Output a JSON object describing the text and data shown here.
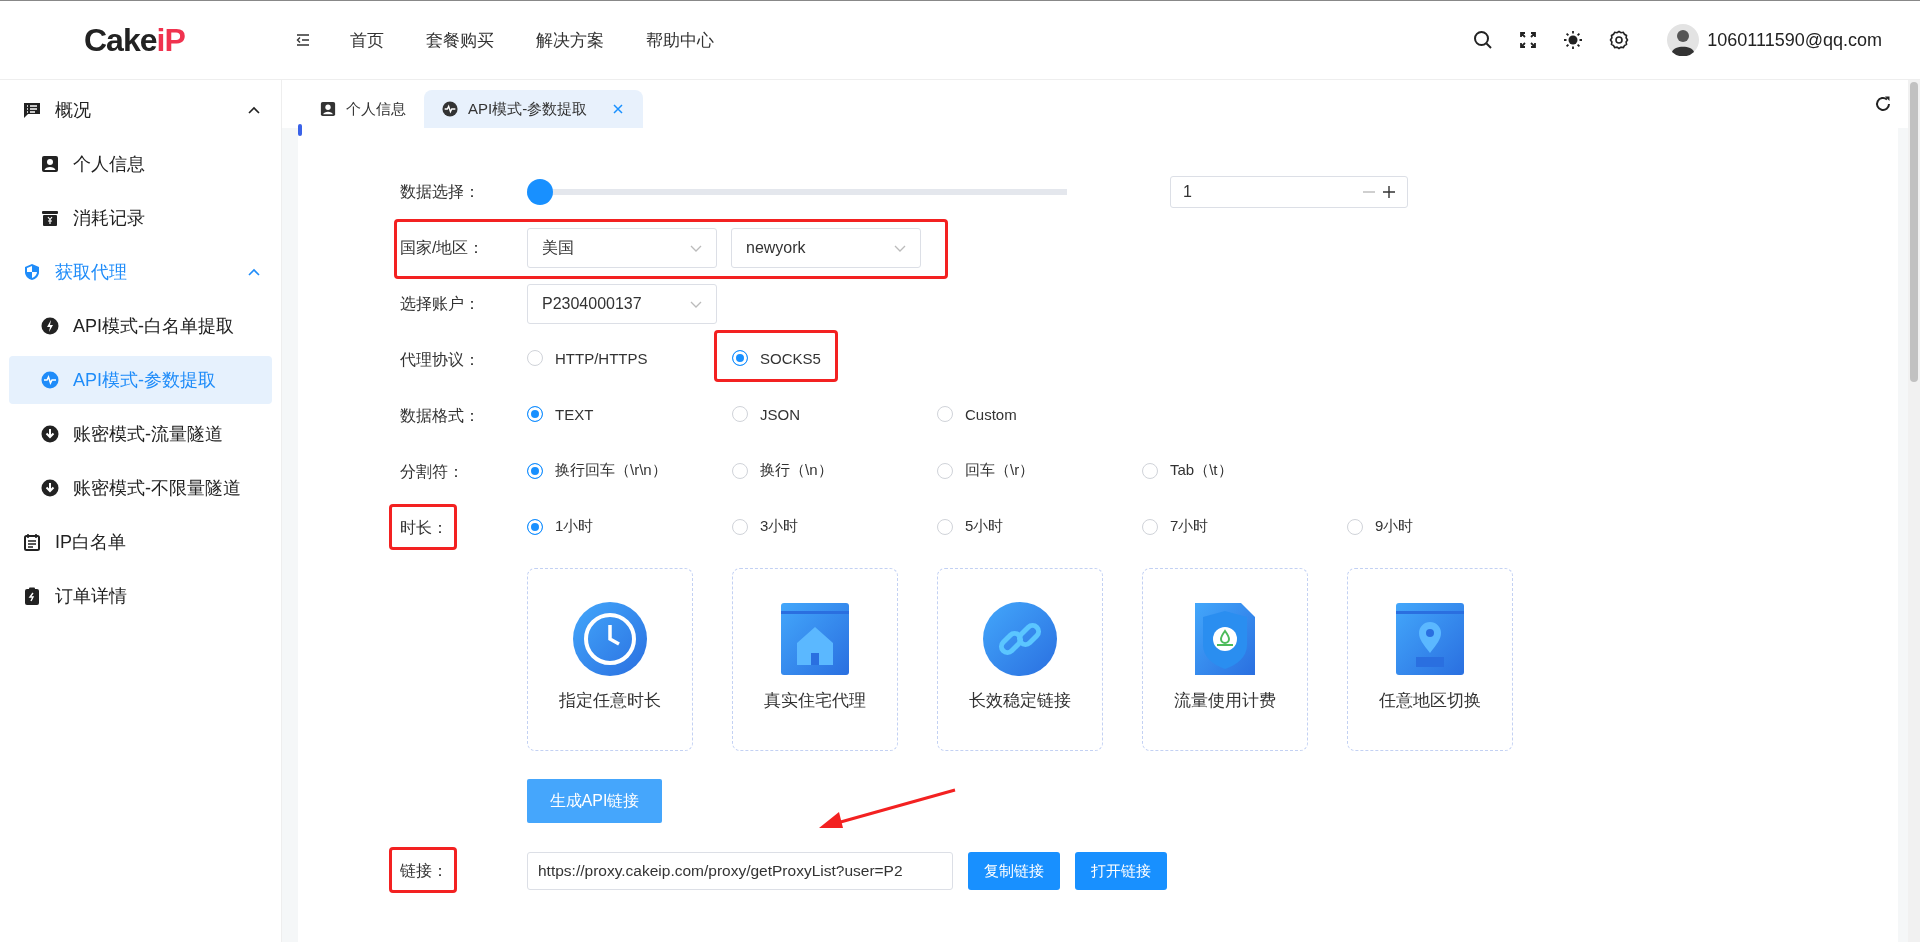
{
  "header": {
    "logo": {
      "text": "Cake",
      "accent": "iP"
    },
    "nav": [
      "首页",
      "套餐购买",
      "解决方案",
      "帮助中心"
    ],
    "user": {
      "email": "1060111590@qq.com"
    }
  },
  "sidebar": {
    "items": [
      {
        "kind": "overview",
        "label": "概况",
        "selected": false,
        "expanded": true,
        "children": [
          {
            "kind": "profile",
            "label": "个人信息",
            "selected": false
          },
          {
            "kind": "billing",
            "label": "消耗记录",
            "selected": false
          }
        ]
      },
      {
        "kind": "proxy",
        "label": "获取代理",
        "selected": false,
        "expanded": true,
        "children": [
          {
            "kind": "bolt",
            "label": "API模式-白名单提取",
            "selected": false
          },
          {
            "kind": "pulse",
            "label": "API模式-参数提取",
            "selected": true
          },
          {
            "kind": "download",
            "label": "账密模式-流量隧道",
            "selected": false
          },
          {
            "kind": "download",
            "label": "账密模式-不限量隧道",
            "selected": false
          }
        ]
      },
      {
        "kind": "list",
        "label": "IP白名单",
        "selected": false
      },
      {
        "kind": "order",
        "label": "订单详情",
        "selected": false
      }
    ]
  },
  "tabs": [
    {
      "kind": "profile",
      "label": "个人信息",
      "selected": false,
      "closable": false
    },
    {
      "kind": "pulse",
      "label": "API模式-参数提取",
      "selected": true,
      "closable": true
    }
  ],
  "form": {
    "rows": [
      {
        "kind": "slider",
        "label": "数据选择：",
        "label_annotated": false,
        "row_annotated": false,
        "level": 0,
        "number": "1"
      },
      {
        "kind": "selects",
        "label": "国家/地区：",
        "label_annotated": false,
        "row_annotated": true,
        "selects": [
          "美国",
          "newyork"
        ]
      },
      {
        "kind": "selects",
        "label": "选择账户：",
        "label_annotated": false,
        "row_annotated": false,
        "selects": [
          "P2304000137"
        ]
      },
      {
        "kind": "radios",
        "label": "代理协议：",
        "label_annotated": false,
        "row_annotated": false,
        "options": [
          {
            "label": "HTTP/HTTPS",
            "selected": false,
            "annotated": false
          },
          {
            "label": "SOCKS5",
            "selected": true,
            "annotated": true
          }
        ]
      },
      {
        "kind": "radios",
        "label": "数据格式：",
        "label_annotated": false,
        "row_annotated": false,
        "options": [
          {
            "label": "TEXT",
            "selected": true,
            "annotated": false
          },
          {
            "label": "JSON",
            "selected": false,
            "annotated": false
          },
          {
            "label": "Custom",
            "selected": false,
            "annotated": false
          }
        ]
      },
      {
        "kind": "radios",
        "label": "分割符：",
        "label_annotated": false,
        "row_annotated": false,
        "options": [
          {
            "label": "换行回车（\\r\\n）",
            "selected": true,
            "annotated": false
          },
          {
            "label": "换行（\\n）",
            "selected": false,
            "annotated": false
          },
          {
            "label": "回车（\\r）",
            "selected": false,
            "annotated": false
          },
          {
            "label": "Tab（\\t）",
            "selected": false,
            "annotated": false
          }
        ]
      },
      {
        "kind": "radios",
        "label": "时长：",
        "label_annotated": true,
        "row_annotated": false,
        "options": [
          {
            "label": "1小时",
            "selected": true,
            "annotated": false
          },
          {
            "label": "3小时",
            "selected": false,
            "annotated": false
          },
          {
            "label": "5小时",
            "selected": false,
            "annotated": false
          },
          {
            "label": "7小时",
            "selected": false,
            "annotated": false
          },
          {
            "label": "9小时",
            "selected": false,
            "annotated": false
          }
        ]
      }
    ],
    "features": [
      {
        "kind": "clock",
        "label": "指定任意时长"
      },
      {
        "kind": "house",
        "label": "真实住宅代理"
      },
      {
        "kind": "link",
        "label": "长效稳定链接"
      },
      {
        "kind": "shield",
        "label": "流量使用计费"
      },
      {
        "kind": "pin",
        "label": "任意地区切换"
      }
    ],
    "generate_button": "生成API链接",
    "link": {
      "label": "链接：",
      "label_annotated": true,
      "value": "https://proxy.cakeip.com/proxy/getProxyList?user=P2",
      "buttons": [
        "复制链接",
        "打开链接"
      ],
      "arrow": true
    }
  }
}
